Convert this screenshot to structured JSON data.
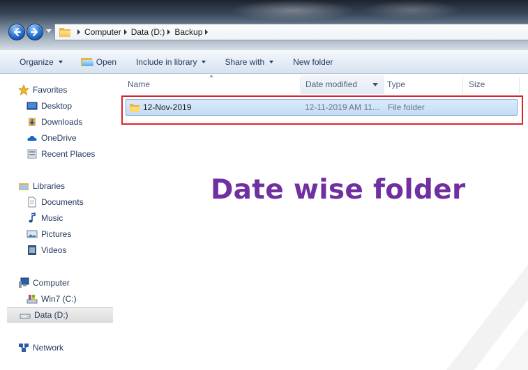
{
  "address": {
    "breadcrumbs": [
      "Computer",
      "Data (D:)",
      "Backup"
    ]
  },
  "toolbar": {
    "organize": "Organize",
    "open": "Open",
    "include_in_library": "Include in library",
    "share_with": "Share with",
    "new_folder": "New folder"
  },
  "nav": {
    "favorites": "Favorites",
    "desktop": "Desktop",
    "downloads": "Downloads",
    "onedrive": "OneDrive",
    "recent_places": "Recent Places",
    "libraries": "Libraries",
    "documents": "Documents",
    "music": "Music",
    "pictures": "Pictures",
    "videos": "Videos",
    "computer": "Computer",
    "win7": "Win7 (C:)",
    "data": "Data (D:)",
    "network": "Network"
  },
  "columns": {
    "name": "Name",
    "date_modified": "Date modified",
    "type": "Type",
    "size": "Size"
  },
  "files": [
    {
      "name": "12-Nov-2019",
      "date_modified": "12-11-2019 AM 11...",
      "type": "File folder"
    }
  ],
  "overlay": {
    "caption": "Date wise folder",
    "color": "#7030a0"
  },
  "colors": {
    "highlight_border": "#d8232a",
    "selection_fill": "#cde2f9",
    "toolbar_text": "#1e395b"
  }
}
